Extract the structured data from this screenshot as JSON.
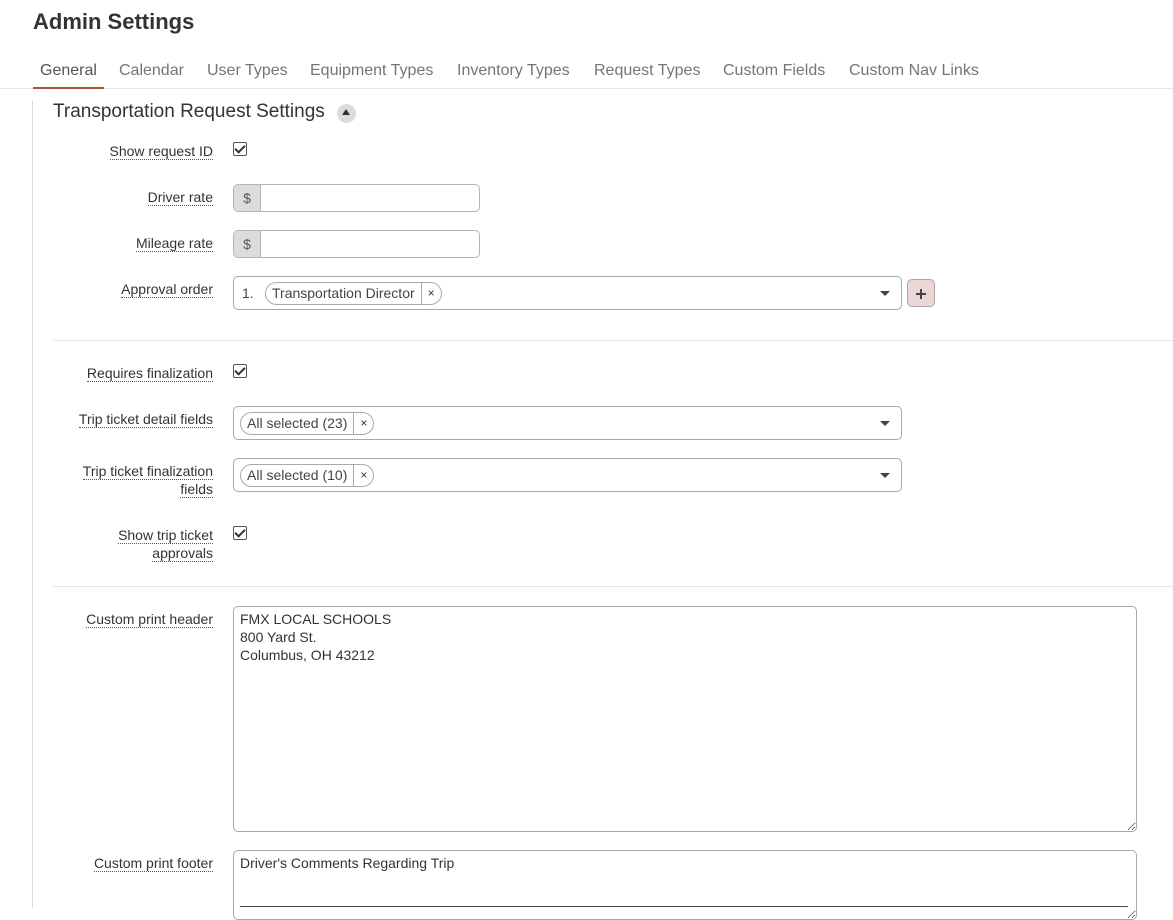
{
  "page": {
    "title": "Admin Settings"
  },
  "tabs": [
    {
      "label": "General",
      "active": true
    },
    {
      "label": "Calendar"
    },
    {
      "label": "User Types"
    },
    {
      "label": "Equipment Types"
    },
    {
      "label": "Inventory Types"
    },
    {
      "label": "Request Types"
    },
    {
      "label": "Custom Fields"
    },
    {
      "label": "Custom Nav Links"
    }
  ],
  "section": {
    "title": "Transportation Request Settings",
    "collapse_icon": "caret-up-icon"
  },
  "fields": {
    "show_request_id": {
      "label": "Show request ID",
      "checked": true
    },
    "driver_rate": {
      "label": "Driver rate",
      "prefix": "$",
      "value": ""
    },
    "mileage_rate": {
      "label": "Mileage rate",
      "prefix": "$",
      "value": ""
    },
    "approval_order": {
      "label": "Approval order",
      "index": "1.",
      "selected": "Transportation Director",
      "remove": "×",
      "add_icon": "plus-icon"
    },
    "requires_finalization": {
      "label": "Requires finalization",
      "checked": true
    },
    "trip_ticket_detail_fields": {
      "label": "Trip ticket detail fields",
      "selected": "All selected (23)",
      "remove": "×"
    },
    "trip_ticket_finalization_fields": {
      "label_line1": "Trip ticket finalization",
      "label_line2": "fields",
      "selected": "All selected (10)",
      "remove": "×"
    },
    "show_trip_ticket_approvals": {
      "label_line1": "Show trip ticket",
      "label_line2": "approvals",
      "checked": true
    },
    "custom_print_header": {
      "label": "Custom print header",
      "value": "FMX LOCAL SCHOOLS\n800 Yard St.\nColumbus, OH 43212"
    },
    "custom_print_footer": {
      "label": "Custom print footer",
      "value": "Driver's Comments Regarding Trip\n\n________________________________________________________________________________________________________________________"
    }
  },
  "colors": {
    "accent": "#a6552f",
    "add_button_bg": "#ead7d7"
  }
}
